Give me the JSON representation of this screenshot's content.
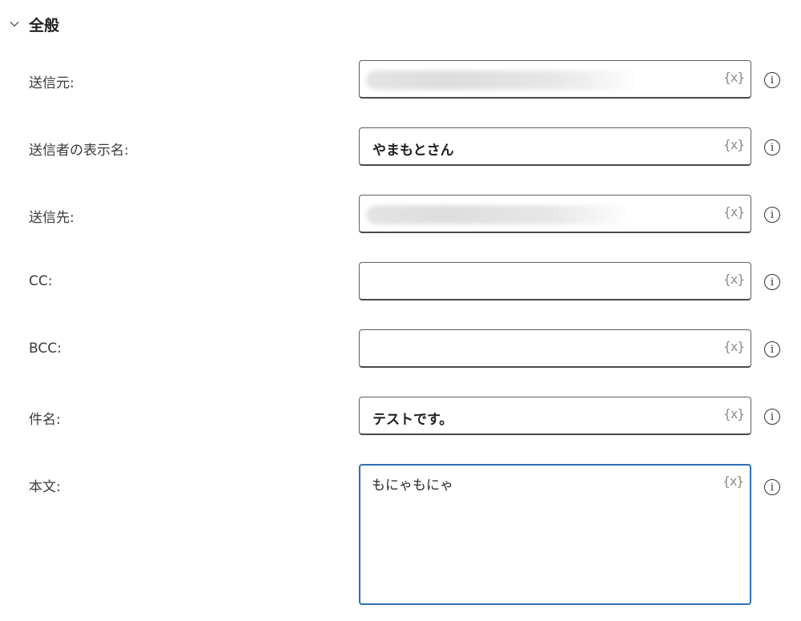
{
  "section": {
    "title": "全般",
    "icon": "chevron-down-icon"
  },
  "fields": {
    "from": {
      "label": "送信元:",
      "value": ""
    },
    "display_name": {
      "label": "送信者の表示名:",
      "value": "やまもとさん"
    },
    "to": {
      "label": "送信先:",
      "value": ""
    },
    "cc": {
      "label": "CC:",
      "value": ""
    },
    "bcc": {
      "label": "BCC:",
      "value": ""
    },
    "subject": {
      "label": "件名:",
      "value": "テストです。"
    },
    "body": {
      "label": "本文:",
      "value": "もにゃもにゃ"
    }
  },
  "variable_icon_text": "{x}",
  "info_icon_text": "i",
  "colors": {
    "focused_border": "#2f6fb8",
    "field_border": "#616161",
    "icon_gray": "#8a8a8a"
  }
}
